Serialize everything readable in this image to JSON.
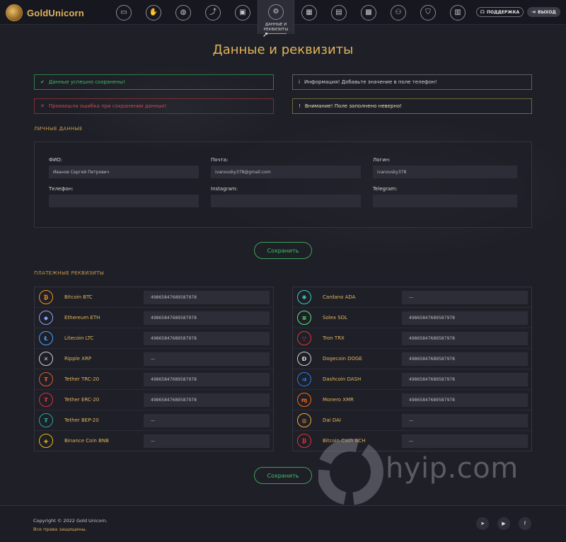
{
  "brand": {
    "name": "GoldUnicorn"
  },
  "nav": {
    "items": [
      {
        "icon": "monitor-icon",
        "glyph": "▭"
      },
      {
        "icon": "hand-coin-icon",
        "glyph": "✋"
      },
      {
        "icon": "coins-icon",
        "glyph": "◍"
      },
      {
        "icon": "chart-arrow-icon",
        "glyph": "⤴"
      },
      {
        "icon": "wallet-icon",
        "glyph": "▣"
      },
      {
        "icon": "gear-icon",
        "glyph": "⚙"
      },
      {
        "icon": "calendar-icon",
        "glyph": "▦"
      },
      {
        "icon": "presentation-icon",
        "glyph": "▤"
      },
      {
        "icon": "briefcase-icon",
        "glyph": "▩"
      },
      {
        "icon": "team-icon",
        "glyph": "⚇"
      },
      {
        "icon": "shield-icon",
        "glyph": "⛉"
      },
      {
        "icon": "calculator-icon",
        "glyph": "▥"
      }
    ],
    "active_label": "ДАННЫЕ И РЕКВИЗИТЫ",
    "support": "ПОДДЕРЖКА",
    "exit": "ВЫХОД"
  },
  "page": {
    "title": "Данные и реквизиты"
  },
  "alerts": {
    "success": "Данные успешно сохранены!",
    "info": "Информация! Добавьте значение в поле телефон!",
    "error": "Произошла ошибка при сохранении данных!",
    "warning": "Внимание! Поле заполнено неверно!"
  },
  "personal": {
    "section_title": "ЛИЧНЫЕ ДАННЫЕ",
    "fio_label": "ФИО:",
    "fio_value": "Иванов Сергей Петрович",
    "email_label": "Почта:",
    "email_value": "ivanovsky378@gmail.com",
    "login_label": "Логин:",
    "login_value": "ivanovsky378",
    "phone_label": "Телефон:",
    "phone_value": "",
    "instagram_label": "Instagram:",
    "instagram_value": "",
    "telegram_label": "Telegram:",
    "telegram_value": "",
    "save": "Сохранить"
  },
  "payments": {
    "section_title": "ПЛАТЕЖНЫЕ РЕКВИЗИТЫ",
    "save": "Сохранить",
    "left": [
      {
        "name": "Bitcoin BTC",
        "value": "498658476895879​78",
        "icon": "bitcoin-icon",
        "glyph": "₿",
        "color": "#f7931a"
      },
      {
        "name": "Ethereum ETH",
        "value": "49865847689587978",
        "icon": "ethereum-icon",
        "glyph": "◆",
        "color": "#8ea4ff"
      },
      {
        "name": "Litecoin LTC",
        "value": "49865847689587978",
        "icon": "litecoin-icon",
        "glyph": "Ł",
        "color": "#4aa3ff"
      },
      {
        "name": "Ripple XRP",
        "value": "—",
        "icon": "ripple-icon",
        "glyph": "✕",
        "color": "#d0d0d0"
      },
      {
        "name": "Tether TRC-20",
        "value": "49865847689587978",
        "icon": "tether-trc20-icon",
        "glyph": "₮",
        "color": "#e05a2a"
      },
      {
        "name": "Tether ERC-20",
        "value": "49865847689587978",
        "icon": "tether-erc20-icon",
        "glyph": "₮",
        "color": "#d6333b"
      },
      {
        "name": "Tether BEP-20",
        "value": "—",
        "icon": "tether-bep20-icon",
        "glyph": "₮",
        "color": "#26a69a"
      },
      {
        "name": "Binance Coin BNB",
        "value": "—",
        "icon": "binance-icon",
        "glyph": "◈",
        "color": "#f0b90b"
      }
    ],
    "right": [
      {
        "name": "Cardano ADA",
        "value": "—",
        "icon": "cardano-icon",
        "glyph": "✺",
        "color": "#3ac9c0"
      },
      {
        "name": "Solex SOL",
        "value": "49865847689587978",
        "icon": "solana-icon",
        "glyph": "≡",
        "color": "#5ee37a"
      },
      {
        "name": "Tron TRX",
        "value": "49865847689587978",
        "icon": "tron-icon",
        "glyph": "▽",
        "color": "#e0343a"
      },
      {
        "name": "Dogecoin DOGE",
        "value": "49865847689587978",
        "icon": "dogecoin-icon",
        "glyph": "Đ",
        "color": "#d0d0d0"
      },
      {
        "name": "Dashcoin DASH",
        "value": "49865847689587978",
        "icon": "dash-icon",
        "glyph": "⇉",
        "color": "#2a7de1"
      },
      {
        "name": "Monero XMR",
        "value": "49865847689587978",
        "icon": "monero-icon",
        "glyph": "ɱ",
        "color": "#ff6a13"
      },
      {
        "name": "Dai DAI",
        "value": "—",
        "icon": "dai-icon",
        "glyph": "◎",
        "color": "#f5ac37"
      },
      {
        "name": "Bitcoin Cash BCH",
        "value": "—",
        "icon": "bitcoin-cash-icon",
        "glyph": "₿",
        "color": "#e0343a"
      }
    ]
  },
  "watermark": {
    "text": "hyip.com"
  },
  "footer": {
    "copyright": "Copyright © 2022 Gold Unicorn.",
    "rights": "Все права защищены.",
    "social": [
      {
        "icon": "telegram-icon",
        "glyph": "➤"
      },
      {
        "icon": "youtube-icon",
        "glyph": "▶"
      },
      {
        "icon": "facebook-icon",
        "glyph": "f"
      }
    ]
  }
}
